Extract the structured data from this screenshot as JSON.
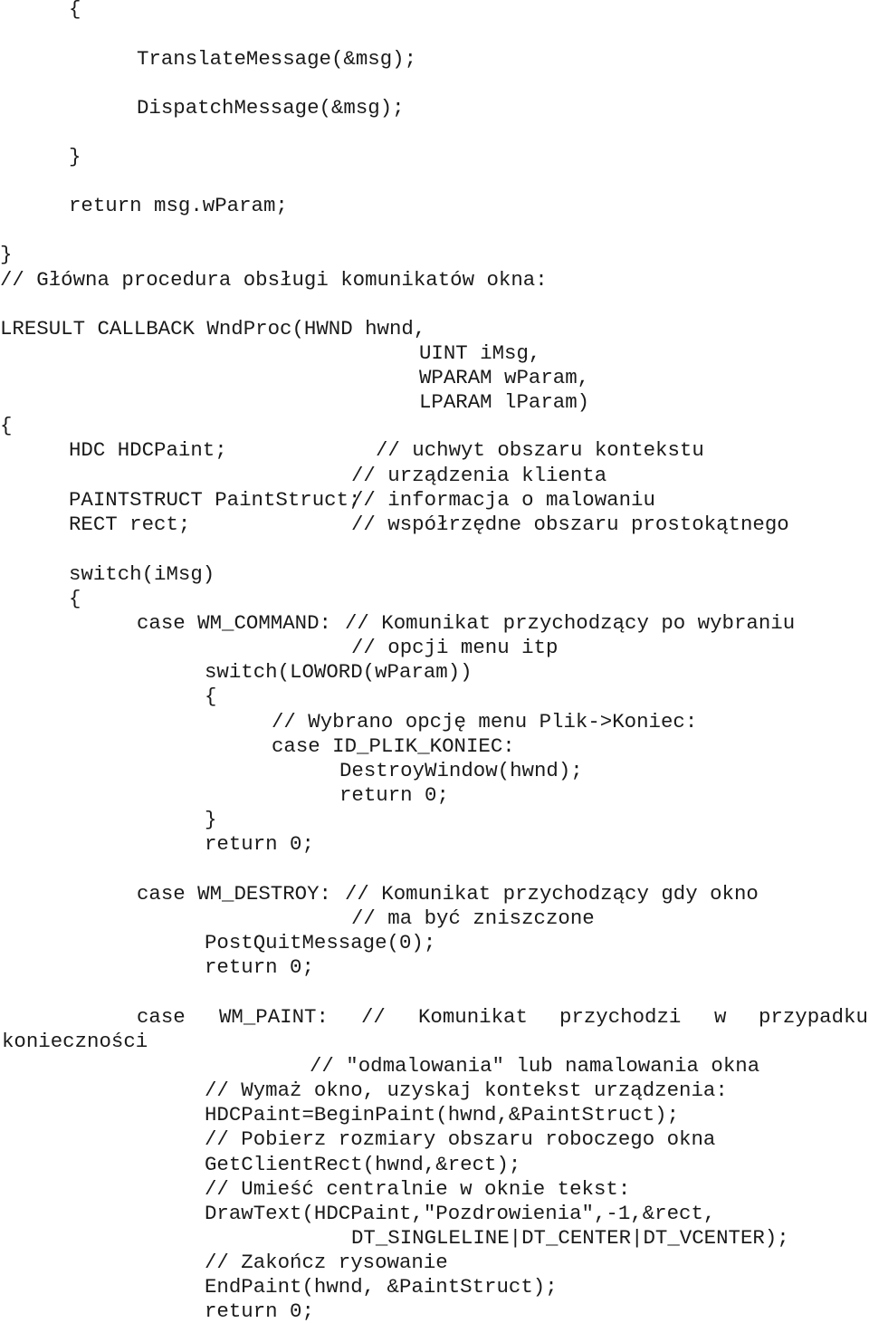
{
  "document": {
    "language": "C",
    "lines": {
      "l01": "{",
      "l02": "TranslateMessage(&msg);",
      "l03": "DispatchMessage(&msg);",
      "l04": "}",
      "l05": "return msg.wParam;",
      "l06": "}",
      "l07": "// Główna procedura obsługi komunikatów okna:",
      "l08": "LRESULT CALLBACK WndProc(HWND hwnd,",
      "l09": "UINT iMsg,",
      "l10": "WPARAM wParam,",
      "l11": "LPARAM lParam)",
      "l12": "{",
      "l13a": "HDC HDCPaint;",
      "l13b": "// uchwyt obszaru kontekstu",
      "l14": "// urządzenia klienta",
      "l15a": "PAINTSTRUCT PaintStruct;",
      "l15b": "// informacja o malowaniu",
      "l16a": "RECT rect;",
      "l16b": "// współrzędne obszaru prostokątnego",
      "l17": "switch(iMsg)",
      "l18": "{",
      "l19a": "case WM_COMMAND:",
      "l19b": "// Komunikat przychodzący po wybraniu",
      "l20": "// opcji menu itp",
      "l21": "switch(LOWORD(wParam))",
      "l22": "{",
      "l23": "// Wybrano opcję menu Plik->Koniec:",
      "l24": "case ID_PLIK_KONIEC:",
      "l25": "DestroyWindow(hwnd);",
      "l26": "return 0;",
      "l27": "}",
      "l28": "return 0;",
      "l29a": "case WM_DESTROY:",
      "l29b": "// Komunikat przychodzący gdy okno",
      "l30": "// ma być zniszczone",
      "l31": "PostQuitMessage(0);",
      "l32": "return 0;",
      "l33": [
        "case",
        "WM_PAINT:",
        "//",
        "Komunikat",
        "przychodzi",
        "w",
        "przypadku"
      ],
      "l34": "konieczności",
      "l35": "// \"odmalowania\" lub namalowania okna",
      "l36": "// Wymaż okno, uzyskaj kontekst urządzenia:",
      "l37": "HDCPaint=BeginPaint(hwnd,&PaintStruct);",
      "l38": "// Pobierz rozmiary obszaru roboczego okna",
      "l39": "GetClientRect(hwnd,&rect);",
      "l40": "// Umieść centralnie w oknie tekst:",
      "l41": "DrawText(HDCPaint,\"Pozdrowienia\",-1,&rect,",
      "l42": "DT_SINGLELINE|DT_CENTER|DT_VCENTER);",
      "l43": "// Zakończ rysowanie",
      "l44": "EndPaint(hwnd, &PaintStruct);",
      "l45": "return 0;"
    }
  }
}
